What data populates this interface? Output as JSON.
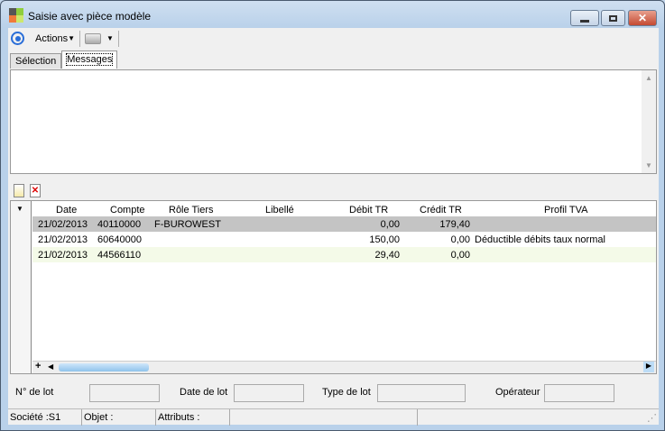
{
  "window": {
    "title": "Saisie avec pièce modèle"
  },
  "toolbar": {
    "actions_label": "Actions"
  },
  "tabs": [
    {
      "label": "Sélection"
    },
    {
      "label": "Messages"
    }
  ],
  "grid": {
    "columns": [
      "Date",
      "Compte",
      "Rôle Tiers",
      "Libellé",
      "Débit TR",
      "Crédit TR",
      "Profil TVA"
    ],
    "rows": [
      {
        "date": "21/02/2013",
        "compte": "40110000",
        "role": "F-BUROWEST",
        "libelle": "",
        "debit": "0,00",
        "credit": "179,40",
        "profil": ""
      },
      {
        "date": "21/02/2013",
        "compte": "60640000",
        "role": "",
        "libelle": "",
        "debit": "150,00",
        "credit": "0,00",
        "profil": "Déductible débits taux normal"
      },
      {
        "date": "21/02/2013",
        "compte": "44566110",
        "role": "",
        "libelle": "",
        "debit": "29,40",
        "credit": "0,00",
        "profil": ""
      }
    ],
    "add_label": "+"
  },
  "lot": {
    "numero_label": "N° de lot",
    "date_label": "Date de lot",
    "type_label": "Type de lot",
    "operateur_label": "Opérateur"
  },
  "status": {
    "societe": "Société :S1",
    "objet": "Objet :",
    "attributs": "Attributs :"
  }
}
